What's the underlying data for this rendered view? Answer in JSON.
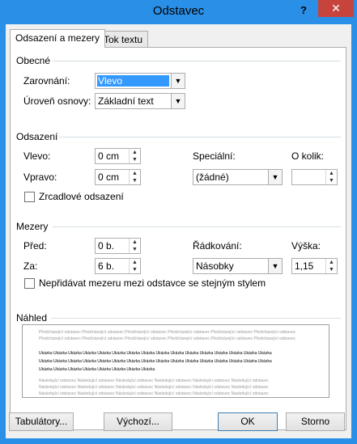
{
  "window": {
    "title": "Odstavec",
    "help_label": "?",
    "close_label": "✕"
  },
  "tabs": [
    {
      "label": "Odsazení a mezery",
      "active": true
    },
    {
      "label": "Tok textu",
      "active": false
    }
  ],
  "general": {
    "section_label": "Obecné",
    "alignment_label": "Zarovnání:",
    "alignment_value": "Vlevo",
    "outline_label": "Úroveň osnovy:",
    "outline_value": "Základní text"
  },
  "indent": {
    "section_label": "Odsazení",
    "left_label": "Vlevo:",
    "left_value": "0 cm",
    "right_label": "Vpravo:",
    "right_value": "0 cm",
    "special_label": "Speciální:",
    "special_value": "(žádné)",
    "by_label": "O kolik:",
    "by_value": "",
    "mirror_label": "Zrcadlové odsazení",
    "mirror_checked": false
  },
  "spacing": {
    "section_label": "Mezery",
    "before_label": "Před:",
    "before_value": "0 b.",
    "after_label": "Za:",
    "after_value": "6 b.",
    "line_label": "Řádkování:",
    "line_value": "Násobky",
    "at_label": "Výška:",
    "at_value": "1,15",
    "no_space_label": "Nepřidávat mezeru mezi odstavce se stejným stylem",
    "no_space_checked": false
  },
  "preview": {
    "section_label": "Náhled",
    "prev_line_1": "Předcházející odstavec Předcházející odstavec Předcházející odstavec Předcházející odstavec Předcházející odstavec Předcházející odstavec",
    "prev_line_2": "Předcházející odstavec Předcházející odstavec Předcházející odstavec Předcházející odstavec Předcházející odstavec Předcházející odstavec",
    "sample_line_1": "Ukázka Ukázka Ukázka Ukázka Ukázka Ukázka Ukázka Ukázka Ukázka Ukázka Ukázka Ukázka Ukázka Ukázka Ukázka Ukázka",
    "sample_line_2": "Ukázka Ukázka Ukázka Ukázka Ukázka Ukázka Ukázka Ukázka Ukázka Ukázka Ukázka Ukázka Ukázka Ukázka Ukázka Ukázka",
    "sample_line_3": "Ukázka Ukázka Ukázka Ukázka Ukázka Ukázka Ukázka Ukázka",
    "next_line_1": "Následující odstavec Následující odstavec Následující odstavec Následující odstavec Následující odstavec Následující odstavec",
    "next_line_2": "Následující odstavec Následující odstavec Následující odstavec Následující odstavec Následující odstavec Následující odstavec",
    "next_line_3": "Následující odstavec Následující odstavec Následující odstavec Následující odstavec Následující odstavec Následující odstavec"
  },
  "buttons": {
    "tabs_label": "Tabulátory...",
    "default_label": "Výchozí...",
    "ok_label": "OK",
    "cancel_label": "Storno"
  },
  "colors": {
    "title_bar": "#2a8fe6",
    "close_button": "#c7443c",
    "selection": "#3399ff"
  }
}
